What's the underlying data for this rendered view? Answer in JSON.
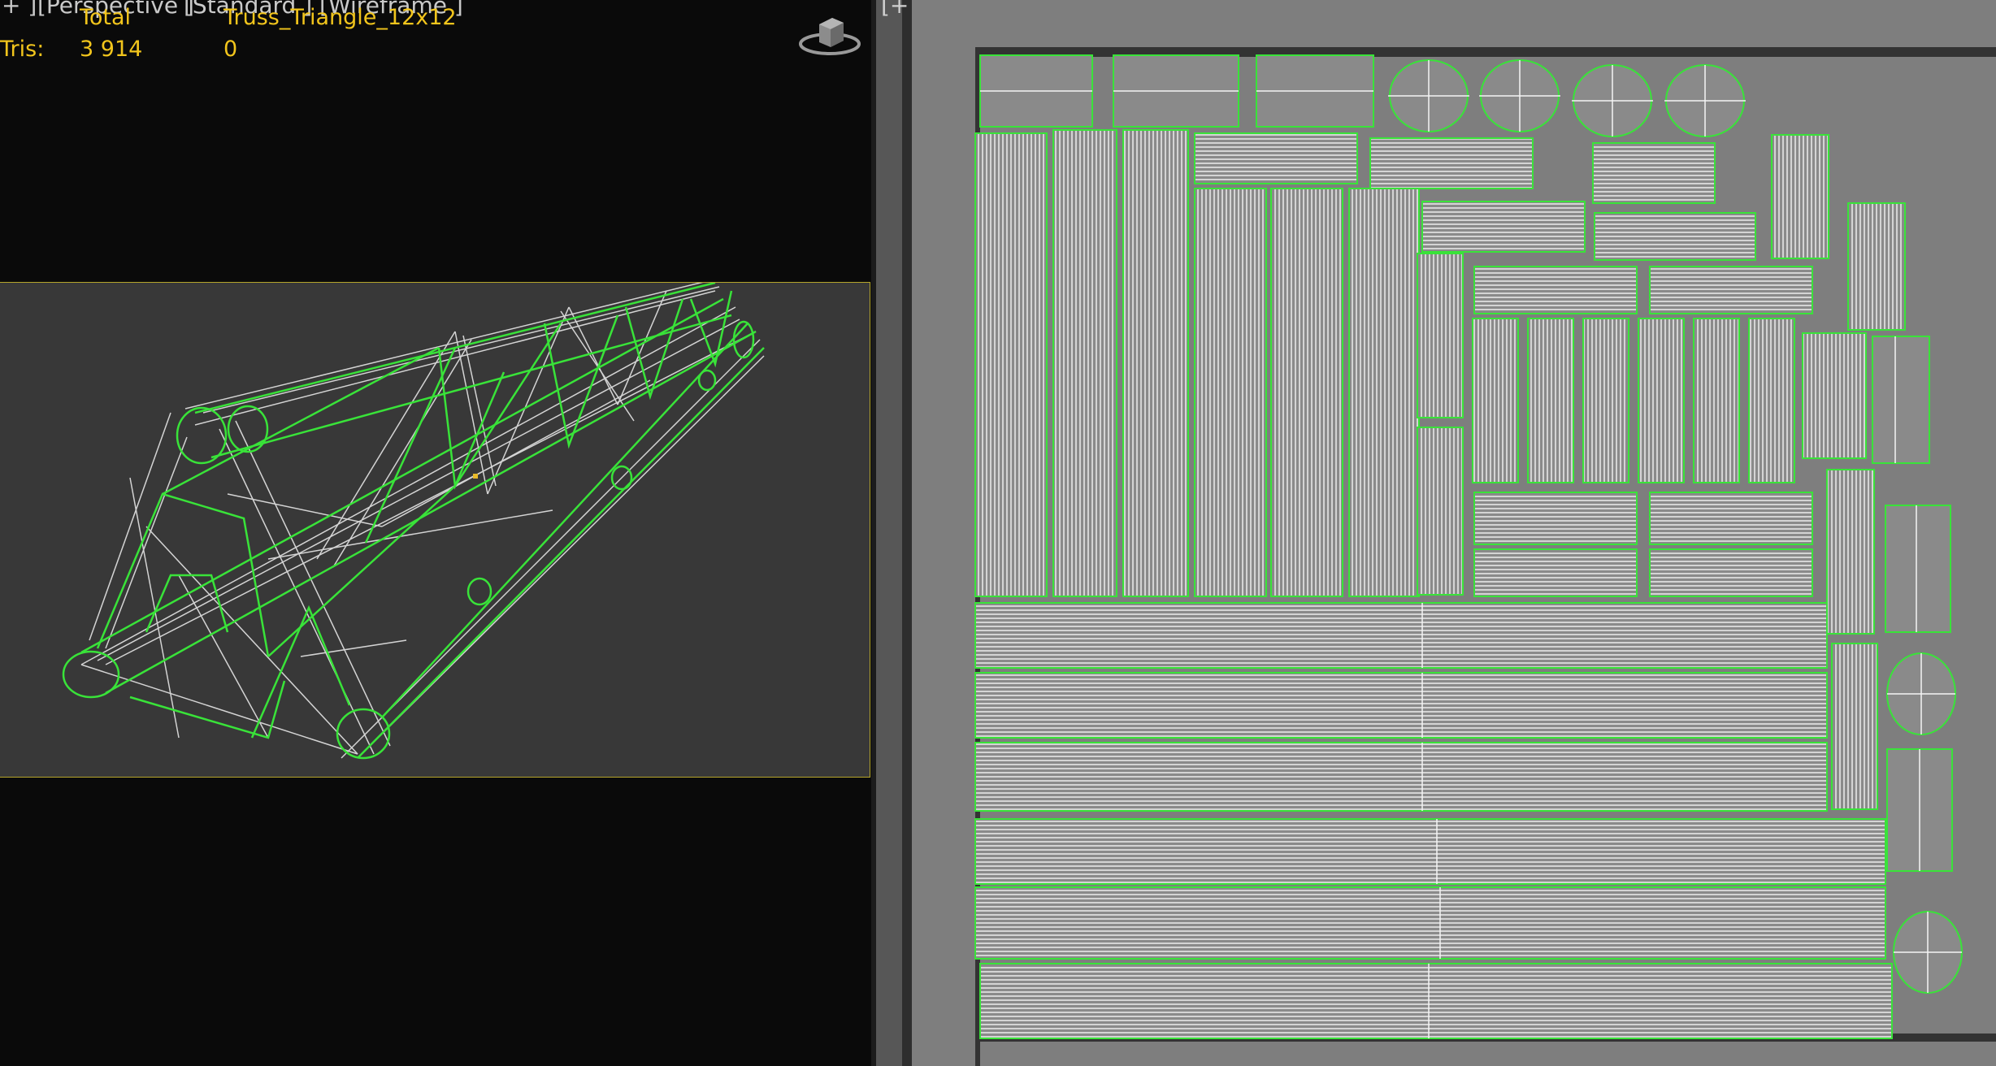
{
  "viewport_left": {
    "label_plus": "+ ]",
    "label_view": "[Perspective ]",
    "label_shading": "[Standard ] [Wireframe ]",
    "stats": {
      "header_total": "Total",
      "header_object": "Truss_Triangle_12x12",
      "row_label": "Tris:",
      "total_value": "3 914",
      "object_value": "0"
    },
    "viewcube_icon": "viewcube-icon"
  },
  "viewport_right": {
    "label": "[+"
  },
  "colors": {
    "wire_green": "#39e339",
    "wire_white": "#f0f0f0",
    "stats_yellow": "#f2c51c",
    "safe_frame": "#b4a52b",
    "uv_background": "#7a7a7a",
    "uv_frame": "#333333"
  }
}
